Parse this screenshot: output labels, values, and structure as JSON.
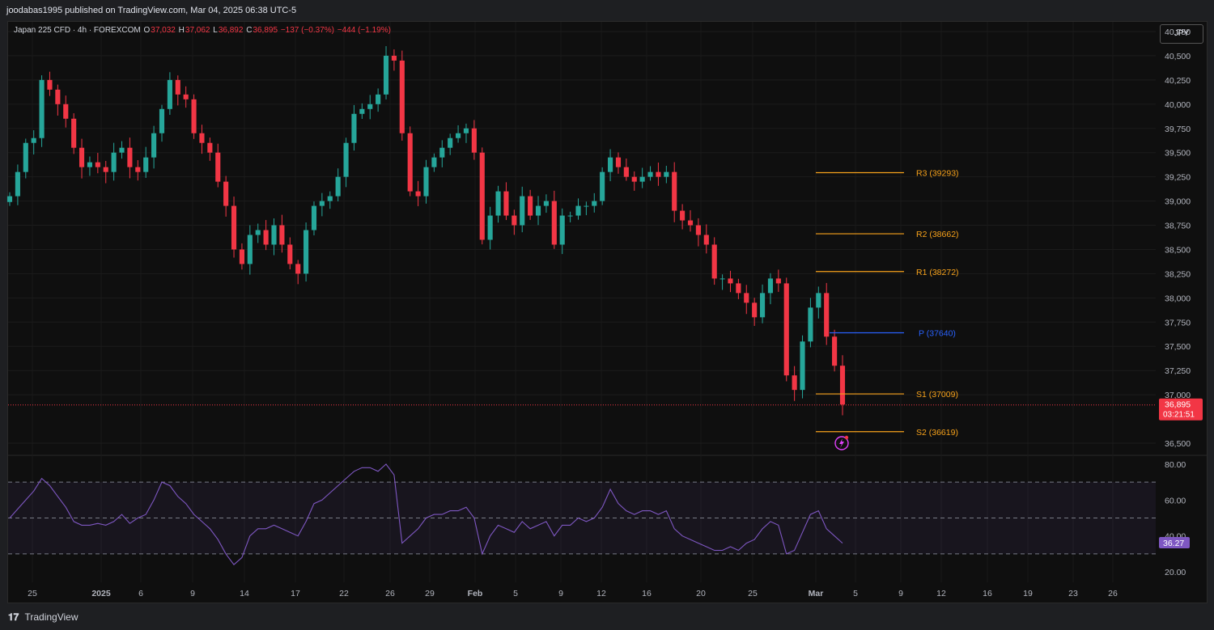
{
  "header": {
    "publisher_line": "joodabas1995 published on TradingView.com, Mar 04, 2025 06:38 UTC-5"
  },
  "legend": {
    "symbol": "Japan 225 CFD · 4h · FOREXCOM",
    "open_label": "O",
    "open": "37,032",
    "high_label": "H",
    "high": "37,062",
    "low_label": "L",
    "low": "36,892",
    "close_label": "C",
    "close": "36,895",
    "change": "−137 (−0.37%)",
    "change2": "−444 (−1.19%)"
  },
  "currency_button": "JPY",
  "footer": {
    "brand": "TradingView"
  },
  "colors": {
    "up": "#26a69a",
    "down": "#f23645",
    "pivot_orange": "#f7a21b",
    "pivot_blue": "#2962ff",
    "rsi_line": "#7e57c2",
    "price_line": "#f23645"
  },
  "chart_data": {
    "type": "candlestick",
    "interval": "4h",
    "price_axis": {
      "ticks": [
        "40,750",
        "40,500",
        "40,250",
        "40,000",
        "39,750",
        "39,500",
        "39,250",
        "39,000",
        "38,750",
        "38,500",
        "38,250",
        "38,000",
        "37,750",
        "37,500",
        "37,250",
        "37,000",
        "36,500"
      ],
      "range": [
        36400,
        40850
      ],
      "last_price_label": "36,895",
      "countdown_label": "03:21:51"
    },
    "time_axis": {
      "ticks": [
        "25",
        "2025",
        "6",
        "9",
        "14",
        "17",
        "22",
        "26",
        "29",
        "Feb",
        "5",
        "9",
        "12",
        "16",
        "20",
        "25",
        "Mar",
        "5",
        "9",
        "12",
        "16",
        "19",
        "23",
        "26"
      ]
    },
    "pivot_levels": [
      {
        "label": "R3 (39293)",
        "value": 39293
      },
      {
        "label": "R2 (38662)",
        "value": 38662
      },
      {
        "label": "R1 (38272)",
        "value": 38272
      },
      {
        "label": "P (37640)",
        "value": 37640
      },
      {
        "label": "S1 (37009)",
        "value": 37009
      },
      {
        "label": "S2 (36619)",
        "value": 36619
      }
    ],
    "close_path": [
      39050,
      39300,
      39600,
      39650,
      40250,
      40150,
      40000,
      39850,
      39550,
      39350,
      39400,
      39350,
      39300,
      39500,
      39550,
      39350,
      39300,
      39450,
      39700,
      39950,
      40250,
      40100,
      40050,
      39700,
      39600,
      39500,
      39200,
      38950,
      38500,
      38350,
      38650,
      38700,
      38550,
      38750,
      38550,
      38350,
      38250,
      38700,
      38950,
      39000,
      39050,
      39250,
      39600,
      39900,
      39950,
      40000,
      40100,
      40500,
      40450,
      39700,
      39100,
      39050,
      39350,
      39450,
      39550,
      39650,
      39700,
      39750,
      39500,
      38600,
      38850,
      39100,
      38850,
      38750,
      39050,
      38850,
      38950,
      39000,
      38550,
      38850,
      38850,
      38950,
      38950,
      39000,
      39300,
      39450,
      39350,
      39250,
      39200,
      39250,
      39300,
      39250,
      39300,
      38900,
      38800,
      38750,
      38650,
      38550,
      38200,
      38200,
      38150,
      38050,
      37950,
      37800,
      38050,
      38200,
      38150,
      37200,
      37050,
      37550,
      37900,
      38050,
      37600,
      37300,
      36900
    ],
    "rsi": {
      "label": "36.27",
      "value": 36.27,
      "levels": [
        70,
        50,
        30
      ],
      "ticks": [
        "80.00",
        "60.00",
        "40.00",
        "20.00"
      ],
      "range": [
        16,
        84
      ],
      "series": [
        50,
        55,
        60,
        65,
        72,
        68,
        62,
        56,
        48,
        46,
        46,
        47,
        46,
        48,
        52,
        47,
        50,
        52,
        60,
        70,
        68,
        62,
        58,
        52,
        48,
        44,
        38,
        30,
        24,
        28,
        40,
        44,
        44,
        46,
        44,
        42,
        40,
        48,
        58,
        60,
        64,
        68,
        72,
        76,
        78,
        78,
        76,
        80,
        74,
        36,
        40,
        44,
        50,
        52,
        52,
        54,
        54,
        56,
        50,
        30,
        40,
        46,
        44,
        42,
        48,
        44,
        46,
        48,
        40,
        46,
        46,
        50,
        48,
        50,
        56,
        66,
        58,
        54,
        52,
        54,
        54,
        52,
        54,
        44,
        40,
        38,
        36,
        34,
        32,
        32,
        34,
        32,
        36,
        38,
        44,
        48,
        46,
        30,
        32,
        42,
        52,
        54,
        44,
        40,
        36
      ]
    }
  }
}
